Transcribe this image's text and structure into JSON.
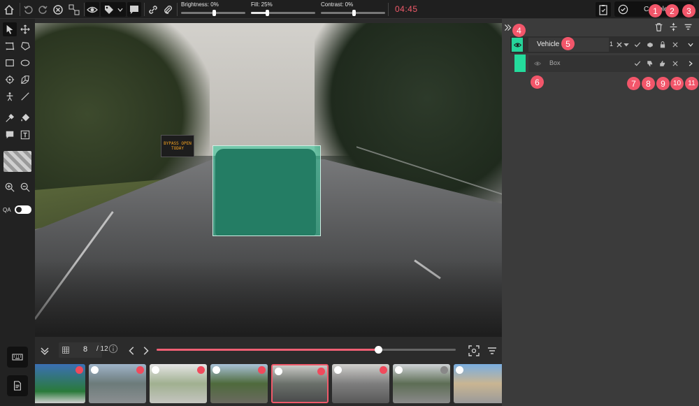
{
  "topbar": {
    "sliders": [
      {
        "label": "Brightness: 0%",
        "value": 0
      },
      {
        "label": "Fill: 25%",
        "value": 25
      },
      {
        "label": "Contrast: 0%",
        "value": 0
      }
    ],
    "timer": "04:45",
    "complete_label": "Complete"
  },
  "canvas": {
    "sign_text": "BYPASS OPEN TODAY"
  },
  "navbar": {
    "current_page": "8",
    "total_pages": "/ 12",
    "progress_fraction": 0.74
  },
  "panel": {
    "object_name": "Vehicle",
    "object_count": "1",
    "shape_label": "Box"
  },
  "badges": [
    "1",
    "2",
    "3",
    "4",
    "5",
    "6",
    "7",
    "8",
    "9",
    "10",
    "11"
  ],
  "colors": {
    "accent": "#f05a6a",
    "annotation": "#24dc9c",
    "badge": "#f2566a"
  }
}
